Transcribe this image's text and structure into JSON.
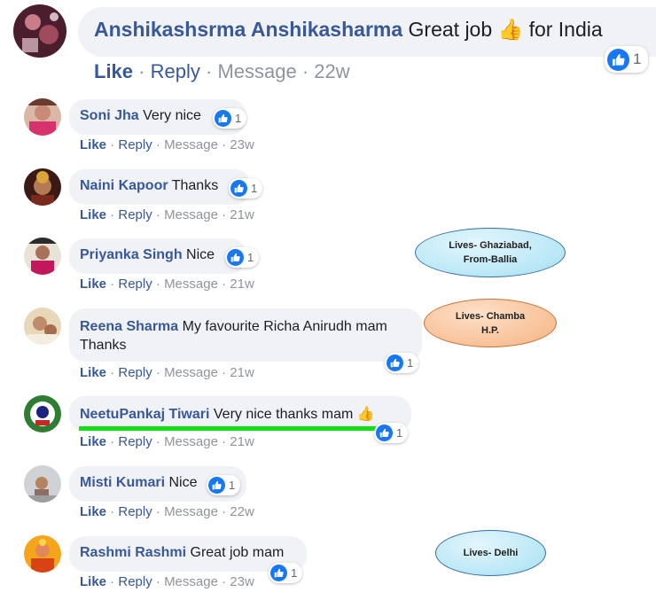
{
  "colors": {
    "name": "#385898",
    "action_link": "#365899",
    "action_muted": "#90949c",
    "bubble": "#f0f2f5",
    "like_badge": "#1877f2",
    "callout_blue": "#b9e7f6",
    "callout_orange": "#f8c197",
    "highlight_underline": "#13e013"
  },
  "main_comment": {
    "author": "Anshikashsrma Anshikasharma",
    "text": "Great job",
    "emoji": "👍",
    "text_after": "for India",
    "reaction_count": "1",
    "actions": {
      "like": "Like",
      "reply": "Reply",
      "message": "Message",
      "time": "22w"
    }
  },
  "replies": [
    {
      "author": "Soni Jha",
      "text": "Very nice",
      "reaction_count": "1",
      "like": "Like",
      "reply": "Reply",
      "message": "Message",
      "time": "23w"
    },
    {
      "author": "Naini Kapoor",
      "text": "Thanks",
      "reaction_count": "1",
      "like": "Like",
      "reply": "Reply",
      "message": "Message",
      "time": "21w"
    },
    {
      "author": "Priyanka Singh",
      "text": "Nice",
      "reaction_count": "1",
      "like": "Like",
      "reply": "Reply",
      "message": "Message",
      "time": "21w"
    },
    {
      "author": "Reena Sharma",
      "text": "My favourite Richa Anirudh mam",
      "text_line2": "Thanks",
      "reaction_count": "1",
      "like": "Like",
      "reply": "Reply",
      "message": "Message",
      "time": "21w"
    },
    {
      "author": "NeetuPankaj Tiwari",
      "text": "Very nice thanks mam",
      "emoji": "👍",
      "reaction_count": "1",
      "like": "Like",
      "reply": "Reply",
      "message": "Message",
      "time": "21w"
    },
    {
      "author": "Misti Kumari",
      "text": "Nice",
      "reaction_count": "1",
      "like": "Like",
      "reply": "Reply",
      "message": "Message",
      "time": "22w"
    },
    {
      "author": "Rashmi Rashmi",
      "text": "Great job mam",
      "reaction_count": "1",
      "like": "Like",
      "reply": "Reply",
      "message": "Message",
      "time": "23w"
    }
  ],
  "annotations": [
    {
      "line1": "Lives- Ghaziabad,",
      "line2": "From-Ballia"
    },
    {
      "line1": "Lives- Chamba",
      "line2": "H.P."
    },
    {
      "line1": "Lives- Delhi"
    }
  ]
}
